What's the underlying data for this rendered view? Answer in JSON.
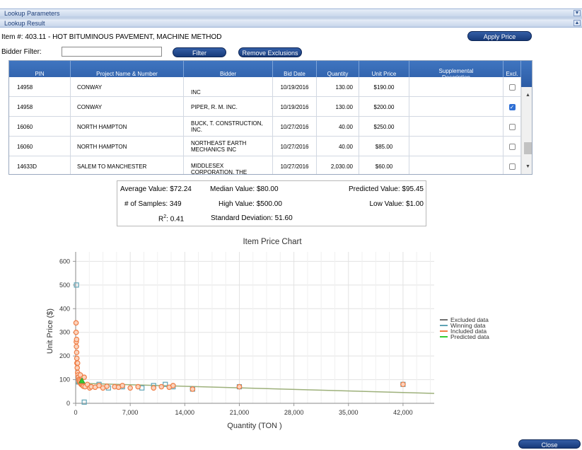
{
  "panels": {
    "lookup_parameters": "Lookup Parameters",
    "lookup_result": "Lookup Result"
  },
  "item_line": "Item #: 403.11 - HOT BITUMINOUS PAVEMENT, MACHINE METHOD",
  "buttons": {
    "apply_price": "Apply Price",
    "filter": "Filter",
    "remove_exclusions": "Remove Exclusions",
    "close": "Close"
  },
  "bidder_filter": {
    "label": "Bidder Filter:",
    "value": ""
  },
  "table": {
    "columns": [
      "PIN",
      "Project Name & Number",
      "Bidder",
      "Bid Date",
      "Quantity",
      "Unit Price",
      "Supplemental Description",
      "Excl."
    ],
    "rows": [
      {
        "pin": "14958",
        "project": "CONWAY",
        "bidder": "INC",
        "bid_date": "10/19/2016",
        "quantity": "130.00",
        "unit_price": "$190.00",
        "supp": "",
        "excl": false
      },
      {
        "pin": "14958",
        "project": "CONWAY",
        "bidder": "PIPER, R. M. INC.",
        "bid_date": "10/19/2016",
        "quantity": "130.00",
        "unit_price": "$200.00",
        "supp": "",
        "excl": true
      },
      {
        "pin": "16060",
        "project": "NORTH HAMPTON",
        "bidder": "BUCK, T. CONSTRUCTION, INC.",
        "bid_date": "10/27/2016",
        "quantity": "40.00",
        "unit_price": "$250.00",
        "supp": "",
        "excl": false
      },
      {
        "pin": "16060",
        "project": "NORTH HAMPTON",
        "bidder": "NORTHEAST EARTH MECHANICS INC",
        "bid_date": "10/27/2016",
        "quantity": "40.00",
        "unit_price": "$85.00",
        "supp": "",
        "excl": false
      },
      {
        "pin": "14633D",
        "project": "SALEM TO MANCHESTER",
        "bidder": "MIDDLESEX CORPORATION, THE",
        "bid_date": "10/27/2016",
        "quantity": "2,030.00",
        "unit_price": "$60.00",
        "supp": "",
        "excl": false
      }
    ]
  },
  "stats": {
    "average": "Average Value: $72.24",
    "median": "Median Value: $80.00",
    "predicted": "Predicted Value: $95.45",
    "samples": "# of Samples: 349",
    "high": "High Value: $500.00",
    "low": "Low Value: $1.00",
    "r2_prefix": "R",
    "r2_sup": "2",
    "r2_value": ": 0.41",
    "std": "Standard Deviation: 51.60"
  },
  "chart_data": {
    "type": "scatter",
    "title": "Item Price Chart",
    "xlabel": "Quantity (TON )",
    "ylabel": "Unit Price ($)",
    "xlim": [
      0,
      46000
    ],
    "ylim": [
      0,
      640
    ],
    "xticks": [
      "0",
      "7,000",
      "14,000",
      "21,000",
      "28,000",
      "35,000",
      "42,000"
    ],
    "xtick_values": [
      0,
      7000,
      14000,
      21000,
      28000,
      35000,
      42000
    ],
    "yticks": [
      "0",
      "100",
      "200",
      "300",
      "400",
      "500",
      "600"
    ],
    "ytick_values": [
      0,
      100,
      200,
      300,
      400,
      500,
      600
    ],
    "legend": [
      "Excluded data",
      "Winning data",
      "Included data",
      "Predicted data"
    ],
    "legend_position": "right",
    "colors": {
      "excluded": "#707070",
      "winning": "#5fa3b5",
      "included": "#f07d44",
      "predicted": "#33cc33",
      "trend": "#9db07a"
    },
    "series": [
      {
        "name": "Winning data",
        "points": [
          [
            100,
            500
          ],
          [
            400,
            90
          ],
          [
            1100,
            5
          ],
          [
            1500,
            75
          ],
          [
            3000,
            80
          ],
          [
            4200,
            65
          ],
          [
            6000,
            70
          ],
          [
            8500,
            65
          ],
          [
            10000,
            75
          ],
          [
            11500,
            80
          ],
          [
            12500,
            70
          ],
          [
            15000,
            60
          ],
          [
            21000,
            70
          ],
          [
            42000,
            80
          ]
        ]
      },
      {
        "name": "Included data",
        "points": [
          [
            50,
            340
          ],
          [
            60,
            300
          ],
          [
            80,
            260
          ],
          [
            100,
            240
          ],
          [
            130,
            215
          ],
          [
            150,
            190
          ],
          [
            160,
            170
          ],
          [
            200,
            150
          ],
          [
            250,
            130
          ],
          [
            300,
            120
          ],
          [
            350,
            110
          ],
          [
            400,
            100
          ],
          [
            450,
            95
          ],
          [
            500,
            90
          ],
          [
            600,
            85
          ],
          [
            700,
            80
          ],
          [
            800,
            78
          ],
          [
            900,
            75
          ],
          [
            1000,
            72
          ],
          [
            1200,
            70
          ],
          [
            1500,
            80
          ],
          [
            1800,
            65
          ],
          [
            2000,
            70
          ],
          [
            2500,
            68
          ],
          [
            3000,
            75
          ],
          [
            3500,
            65
          ],
          [
            4000,
            72
          ],
          [
            5000,
            70
          ],
          [
            5500,
            68
          ],
          [
            6000,
            75
          ],
          [
            7000,
            65
          ],
          [
            8000,
            70
          ],
          [
            10000,
            65
          ],
          [
            11000,
            70
          ],
          [
            12000,
            68
          ],
          [
            12500,
            75
          ],
          [
            15000,
            60
          ],
          [
            21000,
            70
          ],
          [
            42000,
            80
          ],
          [
            250,
            170
          ],
          [
            600,
            120
          ],
          [
            120,
            270
          ],
          [
            1100,
            110
          ]
        ]
      },
      {
        "name": "Predicted data",
        "points": [
          [
            800,
            95
          ]
        ]
      }
    ],
    "trend": {
      "x": [
        0,
        46000
      ],
      "y": [
        85,
        42
      ]
    }
  }
}
